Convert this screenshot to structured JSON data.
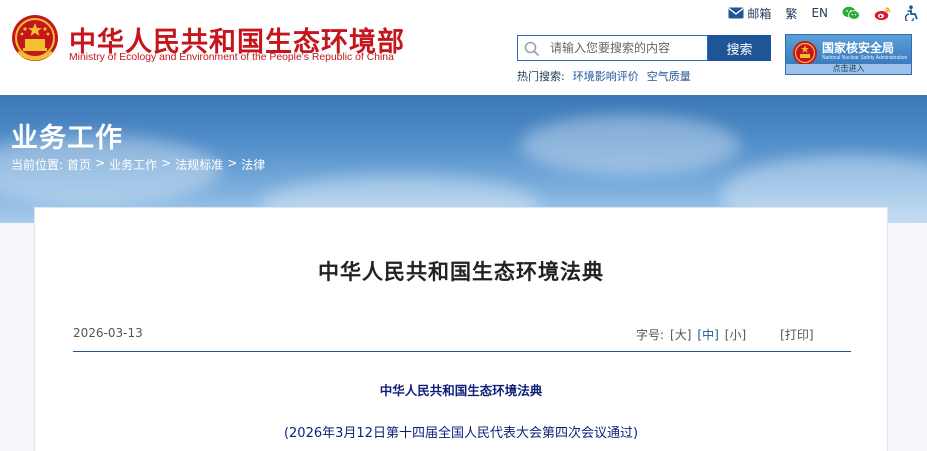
{
  "site": {
    "title_cn": "中华人民共和国生态环境部",
    "title_en": "Ministry of Ecology and Environment of the People's Republic of China"
  },
  "top_links": {
    "mail": "邮箱",
    "traditional": "繁",
    "english": "EN"
  },
  "search": {
    "placeholder": "请输入您要搜索的内容",
    "button": "搜索",
    "hot_label": "热门搜索:",
    "hot_items": [
      "环境影响评价",
      "空气质量"
    ]
  },
  "nnsa": {
    "title": "国家核安全局",
    "subtitle": "National Nuclear Safety Administration",
    "enter": "点击进入"
  },
  "banner": {
    "heading": "业务工作",
    "breadcrumb_label": "当前位置:",
    "crumbs": [
      "首页",
      "业务工作",
      "法规标准",
      "法律"
    ],
    "separator": ">"
  },
  "article": {
    "title": "中华人民共和国生态环境法典",
    "date": "2026-03-13",
    "fontsize_label": "字号:",
    "fontsize_options": [
      "[大]",
      "[中]",
      "[小]"
    ],
    "print": "[打印]",
    "body_title": "中华人民共和国生态环境法典",
    "body_subtitle": "(2026年3月12日第十四届全国人民代表大会第四次会议通过)"
  },
  "colors": {
    "brand_red": "#c4161c",
    "brand_blue": "#1f5596",
    "text_navy": "#0f1f7a"
  }
}
